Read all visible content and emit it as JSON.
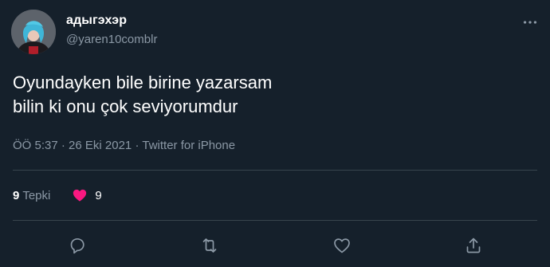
{
  "user": {
    "display_name": "адыгэхэр",
    "handle": "@yaren10comblr",
    "avatar_icon": "profile-photo"
  },
  "tweet": {
    "text": "Oyundayken bile birine yazarsam\nbilin ki onu çok seviyorumdur",
    "time": "ÖÖ 5:37",
    "date": "26 Eki 2021",
    "source": "Twitter for iPhone"
  },
  "stats": {
    "retweet_count": "9",
    "retweet_label": "Tepki",
    "like_count": "9"
  },
  "actions": {
    "reply_icon": "reply-icon",
    "retweet_icon": "retweet-icon",
    "like_icon": "heart-outline-icon",
    "share_icon": "share-icon",
    "more_icon": "more-horizontal-icon"
  },
  "colors": {
    "background": "#15202b",
    "secondary_text": "#8b98a5",
    "divider": "#38444d",
    "like_pink": "#f91880"
  }
}
